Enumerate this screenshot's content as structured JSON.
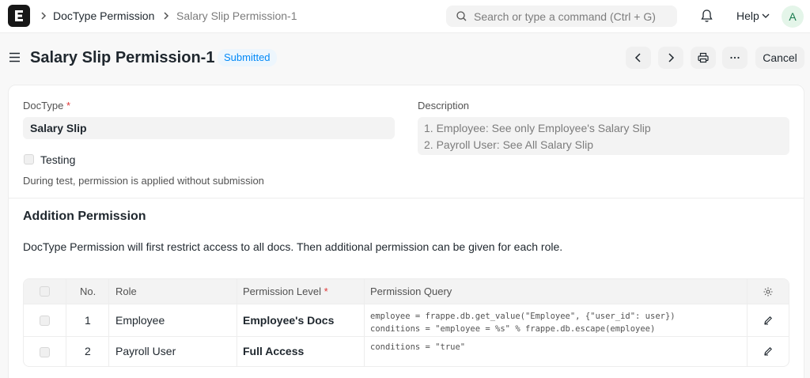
{
  "navbar": {
    "breadcrumbs": [
      "DocType Permission",
      "Salary Slip Permission-1"
    ],
    "search_placeholder": "Search or type a command (Ctrl + G)",
    "help_label": "Help",
    "avatar_initial": "A"
  },
  "page": {
    "title": "Salary Slip Permission-1",
    "status": "Submitted",
    "cancel_label": "Cancel"
  },
  "form": {
    "doctype_label": "DocType",
    "doctype_value": "Salary Slip",
    "description_label": "Description",
    "description_lines": [
      "1. Employee: See only Employee's Salary Slip",
      "2. Payroll User: See All Salary Slip"
    ],
    "testing_label": "Testing",
    "testing_help": "During test, permission is applied without submission",
    "section_title": "Addition Permission",
    "section_description": "DocType Permission will first restrict access to all docs. Then additional permission can be given for each role."
  },
  "table": {
    "columns": [
      "No.",
      "Role",
      "Permission Level",
      "Permission Query"
    ],
    "rows": [
      {
        "no": "1",
        "role": "Employee",
        "level": "Employee's Docs",
        "query_lines": [
          "employee = frappe.db.get_value(\"Employee\", {\"user_id\": user})",
          "conditions = \"employee = %s\" % frappe.db.escape(employee)"
        ]
      },
      {
        "no": "2",
        "role": "Payroll User",
        "level": "Full Access",
        "query_lines": [
          "conditions = \"true\""
        ]
      }
    ]
  },
  "colors": {
    "accent": "#0289f7",
    "required": "#e03636",
    "badge_bg": "#edf6fd"
  }
}
